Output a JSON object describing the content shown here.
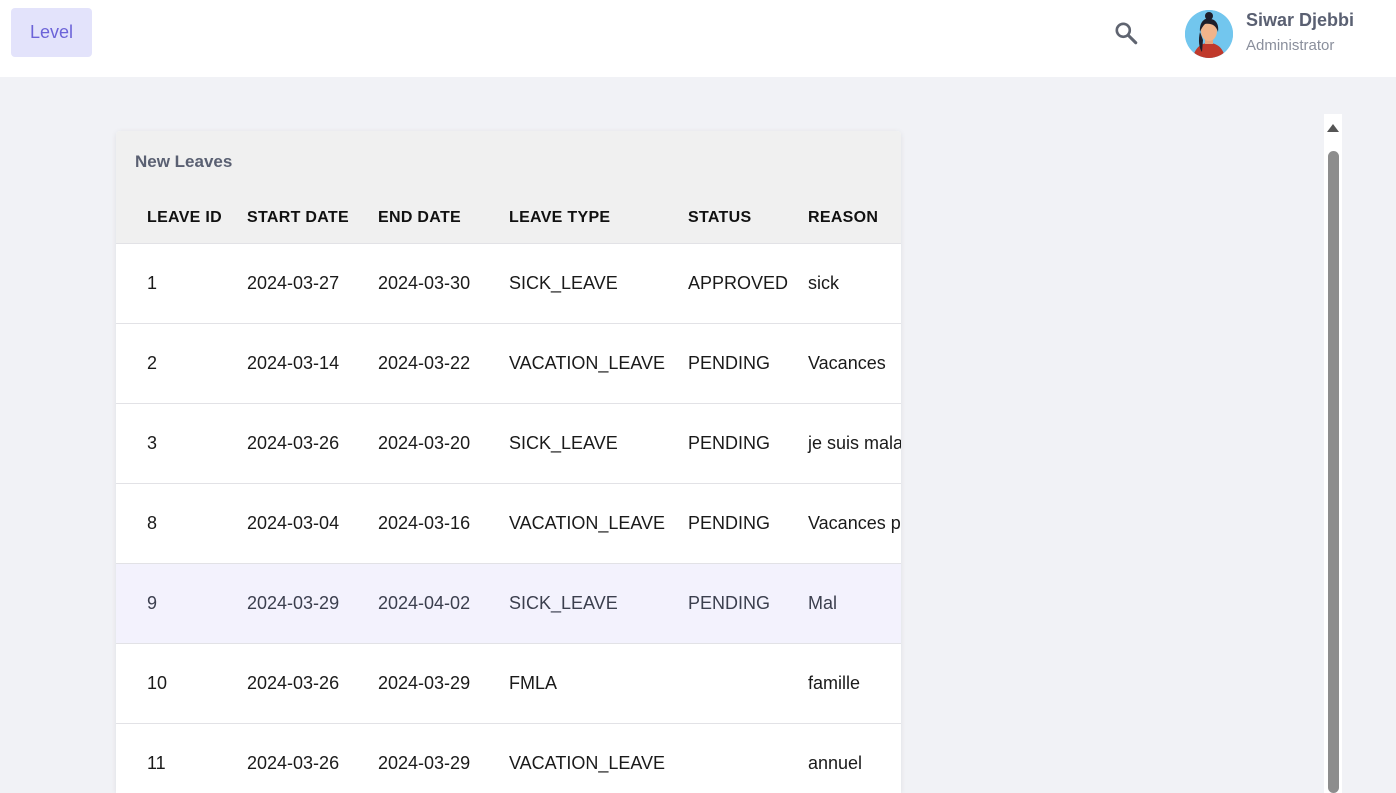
{
  "header": {
    "level_label": "Level",
    "user": {
      "name": "Siwar Djebbi",
      "role": "Administrator"
    }
  },
  "leaves_card": {
    "title": "New Leaves",
    "columns": [
      "LEAVE ID",
      "START DATE",
      "END DATE",
      "LEAVE TYPE",
      "STATUS",
      "REASON"
    ],
    "rows": [
      [
        "1",
        "2024-03-27",
        "2024-03-30",
        "SICK_LEAVE",
        "APPROVED",
        "sick"
      ],
      [
        "2",
        "2024-03-14",
        "2024-03-22",
        "VACATION_LEAVE",
        "PENDING",
        "Vacances"
      ],
      [
        "3",
        "2024-03-26",
        "2024-03-20",
        "SICK_LEAVE",
        "PENDING",
        "je suis malade"
      ],
      [
        "8",
        "2024-03-04",
        "2024-03-16",
        "VACATION_LEAVE",
        "PENDING",
        "Vacances p"
      ],
      [
        "9",
        "2024-03-29",
        "2024-04-02",
        "SICK_LEAVE",
        "PENDING",
        "Mal"
      ],
      [
        "10",
        "2024-03-26",
        "2024-03-29",
        "FMLA",
        "",
        "famille"
      ],
      [
        "11",
        "2024-03-26",
        "2024-03-29",
        "VACATION_LEAVE",
        "",
        "annuel"
      ]
    ],
    "highlighted_row": 4
  },
  "icons": {
    "search": "search-icon",
    "avatar": "user-avatar-icon",
    "scroll_up": "triangle-up-icon"
  },
  "colors": {
    "accent": "#6c63d8",
    "accent_bg": "#e3e3fb",
    "page_bg": "#f1f2f6",
    "row_highlight": "#f3f2fd"
  }
}
